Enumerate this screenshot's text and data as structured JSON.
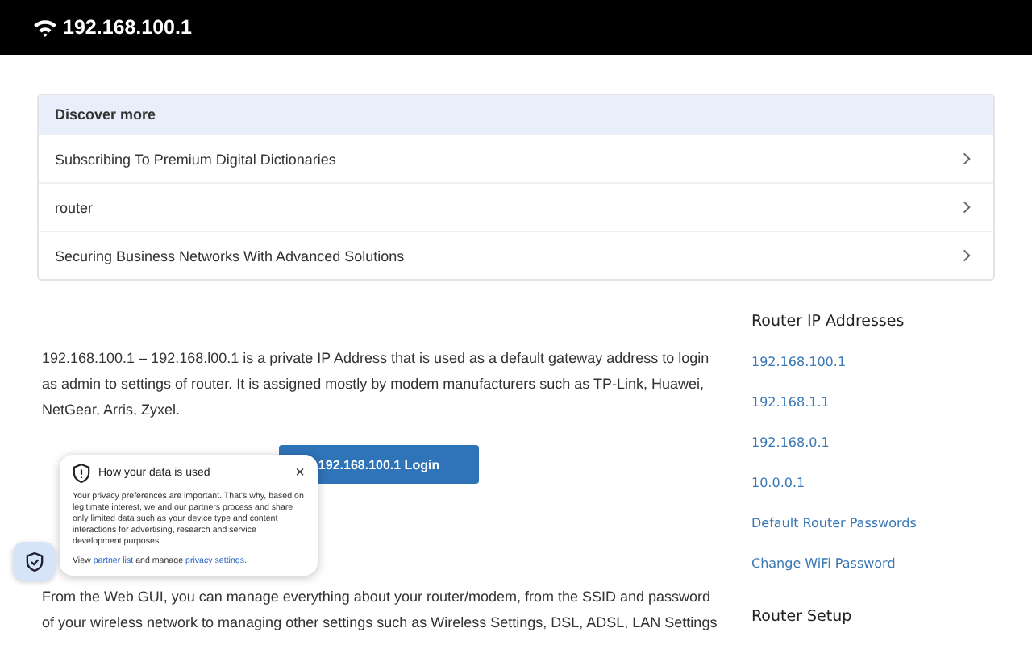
{
  "header": {
    "title": "192.168.100.1"
  },
  "discover": {
    "heading": "Discover more",
    "items": [
      {
        "label": "Subscribing To Premium Digital Dictionaries"
      },
      {
        "label": "router"
      },
      {
        "label": "Securing Business Networks With Advanced Solutions"
      }
    ]
  },
  "article": {
    "intro": "192.168.100.1 – 192.168.l00.1 is a private IP Address that is used as a default gateway address to login as admin to settings of router. It is assigned mostly by modem manufacturers such as TP-Link, Huawei, NetGear, Arris, Zyxel.",
    "login_button": "192.168.100.1 Login",
    "body": "From the Web GUI, you can manage everything about your router/modem, from the SSID and password of your wireless network to managing other settings such as Wireless Settings, DSL, ADSL, LAN Settings"
  },
  "sidebar": {
    "heading": "Router IP Addresses",
    "links": [
      "192.168.100.1",
      "192.168.1.1",
      "192.168.0.1",
      "10.0.0.1",
      "Default Router Passwords",
      "Change WiFi Password"
    ],
    "next_heading": "Router Setup"
  },
  "privacy_popup": {
    "title": "How your data is used",
    "close": "×",
    "text": "Your privacy preferences are important. That's why, based on legitimate interest, we and our partners process and share only limited data such as your device type and content interactions for advertising, research and service development purposes.",
    "footer_parts": [
      {
        "kind": "text",
        "text": "View "
      },
      {
        "kind": "link",
        "text": "partner list"
      },
      {
        "kind": "text",
        "text": " and manage "
      },
      {
        "kind": "link",
        "text": "privacy settings."
      }
    ]
  }
}
